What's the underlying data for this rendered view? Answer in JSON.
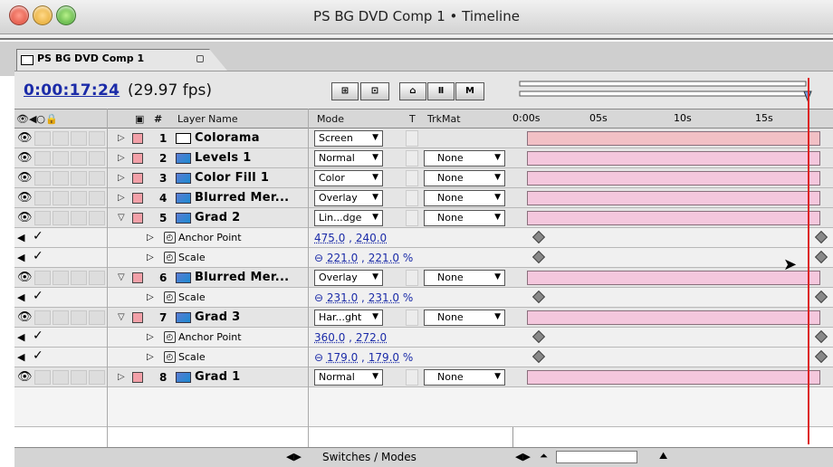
{
  "window": {
    "title": "PS BG DVD Comp 1 • Timeline"
  },
  "tab": {
    "label": "PS BG DVD Comp 1"
  },
  "header": {
    "timecode": "0:00:17:24",
    "fps": "(29.97 fps)"
  },
  "columns": {
    "layer_name": "Layer Name",
    "mode": "Mode",
    "t": "T",
    "trkmat": "TrkMat",
    "hash": "#"
  },
  "ruler": {
    "ticks": [
      "0:00s",
      "05s",
      "10s",
      "15s"
    ]
  },
  "rows": [
    {
      "kind": "layer",
      "num": "1",
      "name": "Colorama",
      "mode": "Screen",
      "trkmat": "",
      "icon": "solid-white",
      "expanded": false
    },
    {
      "kind": "layer",
      "num": "2",
      "name": "Levels 1",
      "mode": "Normal",
      "trkmat": "None",
      "icon": "adjustment",
      "expanded": false
    },
    {
      "kind": "layer",
      "num": "3",
      "name": "Color Fill 1",
      "mode": "Color",
      "trkmat": "None",
      "icon": "adjustment",
      "expanded": false
    },
    {
      "kind": "layer",
      "num": "4",
      "name": "Blurred Mer...",
      "mode": "Overlay",
      "trkmat": "None",
      "icon": "adjustment",
      "expanded": false
    },
    {
      "kind": "layer",
      "num": "5",
      "name": "Grad 2",
      "mode": "Lin...dge",
      "trkmat": "None",
      "icon": "adjustment",
      "expanded": true
    },
    {
      "kind": "prop",
      "name": "Anchor Point",
      "v1": "475.0",
      "v2": "240.0",
      "link": false
    },
    {
      "kind": "prop",
      "name": "Scale",
      "v1": "221.0",
      "v2": "221.0",
      "link": true
    },
    {
      "kind": "layer",
      "num": "6",
      "name": "Blurred Mer...",
      "mode": "Overlay",
      "trkmat": "None",
      "icon": "adjustment",
      "expanded": true
    },
    {
      "kind": "prop",
      "name": "Scale",
      "v1": "231.0",
      "v2": "231.0",
      "link": true
    },
    {
      "kind": "layer",
      "num": "7",
      "name": "Grad 3",
      "mode": "Har...ght",
      "trkmat": "None",
      "icon": "adjustment",
      "expanded": true
    },
    {
      "kind": "prop",
      "name": "Anchor Point",
      "v1": "360.0",
      "v2": "272.0",
      "link": false
    },
    {
      "kind": "prop",
      "name": "Scale",
      "v1": "179.0",
      "v2": "179.0",
      "link": true
    },
    {
      "kind": "layer",
      "num": "8",
      "name": "Grad 1",
      "mode": "Normal",
      "trkmat": "None",
      "icon": "adjustment",
      "expanded": false
    }
  ],
  "footer": {
    "switches": "Switches / Modes"
  },
  "colors": {
    "timecode": "#1b2ba8",
    "bar": "#f4c7dd",
    "current_time": "#d22222",
    "label": "#f2a0a8"
  }
}
